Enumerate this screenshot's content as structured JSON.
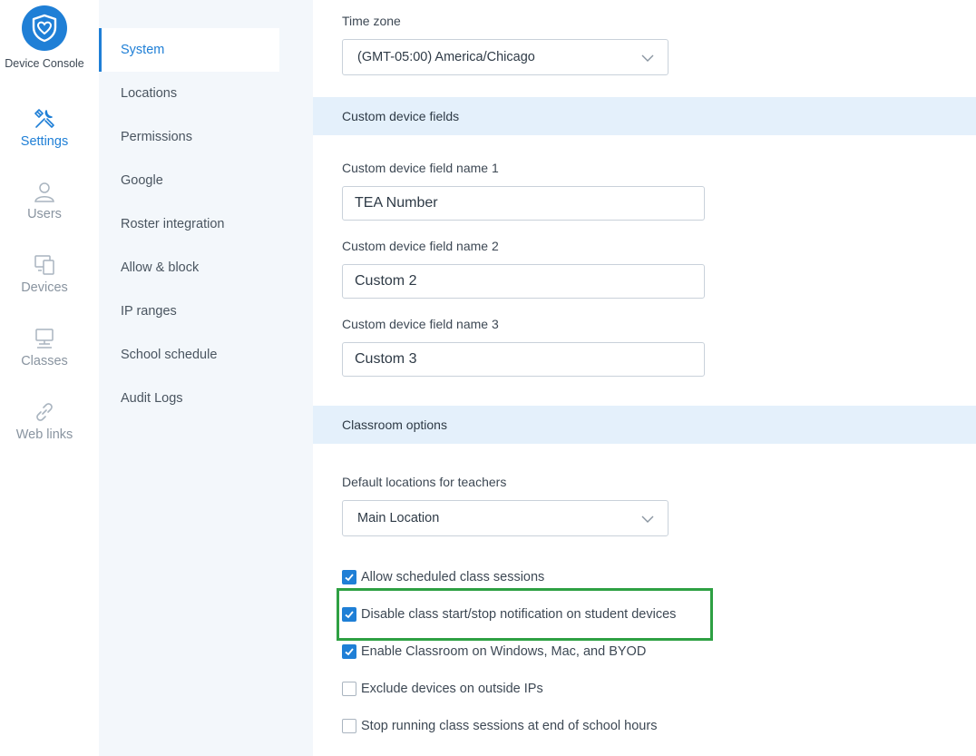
{
  "app": {
    "brand": "Device Console"
  },
  "rail": {
    "items": [
      {
        "label": "Settings",
        "icon": "tools-icon",
        "active": true
      },
      {
        "label": "Users",
        "icon": "user-icon",
        "active": false
      },
      {
        "label": "Devices",
        "icon": "devices-icon",
        "active": false
      },
      {
        "label": "Classes",
        "icon": "classes-icon",
        "active": false
      },
      {
        "label": "Web links",
        "icon": "link-icon",
        "active": false
      }
    ]
  },
  "subnav": {
    "items": [
      {
        "label": "System",
        "active": true
      },
      {
        "label": "Locations"
      },
      {
        "label": "Permissions"
      },
      {
        "label": "Google"
      },
      {
        "label": "Roster integration"
      },
      {
        "label": "Allow & block"
      },
      {
        "label": "IP ranges"
      },
      {
        "label": "School schedule"
      },
      {
        "label": "Audit Logs"
      }
    ]
  },
  "main": {
    "timezone": {
      "label": "Time zone",
      "value": "(GMT-05:00) America/Chicago"
    },
    "custom_fields": {
      "heading": "Custom device fields",
      "fields": [
        {
          "label": "Custom device field name 1",
          "value": "TEA Number"
        },
        {
          "label": "Custom device field name 2",
          "value": "Custom 2"
        },
        {
          "label": "Custom device field name 3",
          "value": "Custom 3"
        }
      ]
    },
    "classroom": {
      "heading": "Classroom options",
      "default_location": {
        "label": "Default locations for teachers",
        "value": "Main Location"
      },
      "options": [
        {
          "label": "Allow scheduled class sessions",
          "checked": true
        },
        {
          "label": "Disable class start/stop notification on student devices",
          "checked": true,
          "highlighted": true
        },
        {
          "label": "Enable Classroom on Windows, Mac, and BYOD",
          "checked": true
        },
        {
          "label": "Exclude devices on outside IPs",
          "checked": false
        },
        {
          "label": "Stop running class sessions at end of school hours",
          "checked": false
        }
      ]
    }
  },
  "colors": {
    "accent": "#1f7fd6",
    "section_bg": "#e4f0fb",
    "nav_bg": "#f3f7fb",
    "highlight": "#2ea043"
  }
}
